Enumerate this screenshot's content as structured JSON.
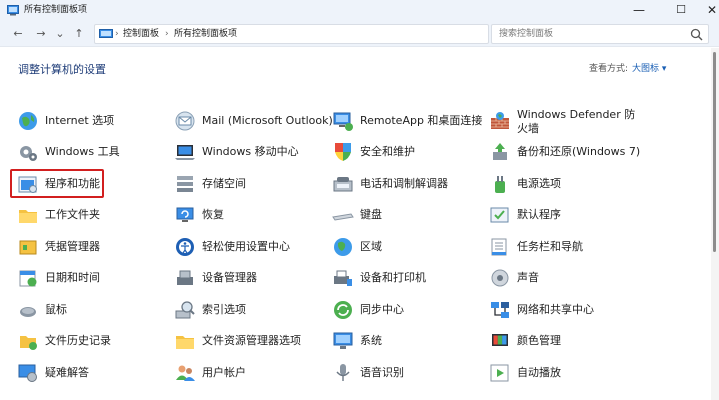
{
  "window": {
    "title": "所有控制面板项"
  },
  "nav": {
    "back": "←",
    "forward": "→",
    "recent": "⌄",
    "up": "↑"
  },
  "address": {
    "crumbs": [
      "控制面板",
      "所有控制面板项"
    ],
    "separator": "›"
  },
  "search": {
    "placeholder": "搜索控制面板"
  },
  "heading": "调整计算机的设置",
  "view": {
    "label": "查看方式:",
    "value": "大图标 ▾"
  },
  "items": [
    {
      "label": "Internet 选项",
      "icon": "internet-options-icon"
    },
    {
      "label": "Mail (Microsoft Outlook)",
      "icon": "mail-icon"
    },
    {
      "label": "RemoteApp 和桌面连接",
      "icon": "remoteapp-icon"
    },
    {
      "label": "Windows Defender 防火墙",
      "icon": "firewall-icon"
    },
    {
      "label": "Windows 工具",
      "icon": "windows-tools-icon"
    },
    {
      "label": "Windows 移动中心",
      "icon": "mobility-center-icon"
    },
    {
      "label": "安全和维护",
      "icon": "security-maintenance-icon"
    },
    {
      "label": "备份和还原(Windows 7)",
      "icon": "backup-restore-icon"
    },
    {
      "label": "程序和功能",
      "icon": "programs-features-icon"
    },
    {
      "label": "存储空间",
      "icon": "storage-spaces-icon"
    },
    {
      "label": "电话和调制解调器",
      "icon": "phone-modem-icon"
    },
    {
      "label": "电源选项",
      "icon": "power-options-icon"
    },
    {
      "label": "工作文件夹",
      "icon": "work-folders-icon"
    },
    {
      "label": "恢复",
      "icon": "recovery-icon"
    },
    {
      "label": "键盘",
      "icon": "keyboard-icon"
    },
    {
      "label": "默认程序",
      "icon": "default-programs-icon"
    },
    {
      "label": "凭据管理器",
      "icon": "credential-manager-icon"
    },
    {
      "label": "轻松使用设置中心",
      "icon": "ease-of-access-icon"
    },
    {
      "label": "区域",
      "icon": "region-icon"
    },
    {
      "label": "任务栏和导航",
      "icon": "taskbar-icon"
    },
    {
      "label": "日期和时间",
      "icon": "date-time-icon"
    },
    {
      "label": "设备管理器",
      "icon": "device-manager-icon"
    },
    {
      "label": "设备和打印机",
      "icon": "devices-printers-icon"
    },
    {
      "label": "声音",
      "icon": "sound-icon"
    },
    {
      "label": "鼠标",
      "icon": "mouse-icon"
    },
    {
      "label": "索引选项",
      "icon": "indexing-options-icon"
    },
    {
      "label": "同步中心",
      "icon": "sync-center-icon"
    },
    {
      "label": "网络和共享中心",
      "icon": "network-sharing-icon"
    },
    {
      "label": "文件历史记录",
      "icon": "file-history-icon"
    },
    {
      "label": "文件资源管理器选项",
      "icon": "explorer-options-icon"
    },
    {
      "label": "系统",
      "icon": "system-icon"
    },
    {
      "label": "颜色管理",
      "icon": "color-management-icon"
    },
    {
      "label": "疑难解答",
      "icon": "troubleshooting-icon"
    },
    {
      "label": "用户帐户",
      "icon": "user-accounts-icon"
    },
    {
      "label": "语音识别",
      "icon": "speech-recognition-icon"
    },
    {
      "label": "自动播放",
      "icon": "autoplay-icon"
    }
  ],
  "highlighted_item": "程序和功能"
}
